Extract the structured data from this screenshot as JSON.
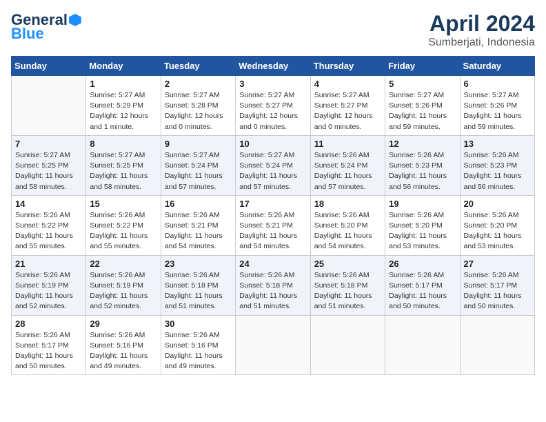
{
  "header": {
    "logo_general": "General",
    "logo_blue": "Blue",
    "month_title": "April 2024",
    "subtitle": "Sumberjati, Indonesia"
  },
  "days_of_week": [
    "Sunday",
    "Monday",
    "Tuesday",
    "Wednesday",
    "Thursday",
    "Friday",
    "Saturday"
  ],
  "weeks": [
    [
      {
        "day": "",
        "info": ""
      },
      {
        "day": "1",
        "info": "Sunrise: 5:27 AM\nSunset: 5:29 PM\nDaylight: 12 hours\nand 1 minute."
      },
      {
        "day": "2",
        "info": "Sunrise: 5:27 AM\nSunset: 5:28 PM\nDaylight: 12 hours\nand 0 minutes."
      },
      {
        "day": "3",
        "info": "Sunrise: 5:27 AM\nSunset: 5:27 PM\nDaylight: 12 hours\nand 0 minutes."
      },
      {
        "day": "4",
        "info": "Sunrise: 5:27 AM\nSunset: 5:27 PM\nDaylight: 12 hours\nand 0 minutes."
      },
      {
        "day": "5",
        "info": "Sunrise: 5:27 AM\nSunset: 5:26 PM\nDaylight: 11 hours\nand 59 minutes."
      },
      {
        "day": "6",
        "info": "Sunrise: 5:27 AM\nSunset: 5:26 PM\nDaylight: 11 hours\nand 59 minutes."
      }
    ],
    [
      {
        "day": "7",
        "info": "Sunrise: 5:27 AM\nSunset: 5:25 PM\nDaylight: 11 hours\nand 58 minutes."
      },
      {
        "day": "8",
        "info": "Sunrise: 5:27 AM\nSunset: 5:25 PM\nDaylight: 11 hours\nand 58 minutes."
      },
      {
        "day": "9",
        "info": "Sunrise: 5:27 AM\nSunset: 5:24 PM\nDaylight: 11 hours\nand 57 minutes."
      },
      {
        "day": "10",
        "info": "Sunrise: 5:27 AM\nSunset: 5:24 PM\nDaylight: 11 hours\nand 57 minutes."
      },
      {
        "day": "11",
        "info": "Sunrise: 5:26 AM\nSunset: 5:24 PM\nDaylight: 11 hours\nand 57 minutes."
      },
      {
        "day": "12",
        "info": "Sunrise: 5:26 AM\nSunset: 5:23 PM\nDaylight: 11 hours\nand 56 minutes."
      },
      {
        "day": "13",
        "info": "Sunrise: 5:26 AM\nSunset: 5:23 PM\nDaylight: 11 hours\nand 56 minutes."
      }
    ],
    [
      {
        "day": "14",
        "info": "Sunrise: 5:26 AM\nSunset: 5:22 PM\nDaylight: 11 hours\nand 55 minutes."
      },
      {
        "day": "15",
        "info": "Sunrise: 5:26 AM\nSunset: 5:22 PM\nDaylight: 11 hours\nand 55 minutes."
      },
      {
        "day": "16",
        "info": "Sunrise: 5:26 AM\nSunset: 5:21 PM\nDaylight: 11 hours\nand 54 minutes."
      },
      {
        "day": "17",
        "info": "Sunrise: 5:26 AM\nSunset: 5:21 PM\nDaylight: 11 hours\nand 54 minutes."
      },
      {
        "day": "18",
        "info": "Sunrise: 5:26 AM\nSunset: 5:20 PM\nDaylight: 11 hours\nand 54 minutes."
      },
      {
        "day": "19",
        "info": "Sunrise: 5:26 AM\nSunset: 5:20 PM\nDaylight: 11 hours\nand 53 minutes."
      },
      {
        "day": "20",
        "info": "Sunrise: 5:26 AM\nSunset: 5:20 PM\nDaylight: 11 hours\nand 53 minutes."
      }
    ],
    [
      {
        "day": "21",
        "info": "Sunrise: 5:26 AM\nSunset: 5:19 PM\nDaylight: 11 hours\nand 52 minutes."
      },
      {
        "day": "22",
        "info": "Sunrise: 5:26 AM\nSunset: 5:19 PM\nDaylight: 11 hours\nand 52 minutes."
      },
      {
        "day": "23",
        "info": "Sunrise: 5:26 AM\nSunset: 5:18 PM\nDaylight: 11 hours\nand 51 minutes."
      },
      {
        "day": "24",
        "info": "Sunrise: 5:26 AM\nSunset: 5:18 PM\nDaylight: 11 hours\nand 51 minutes."
      },
      {
        "day": "25",
        "info": "Sunrise: 5:26 AM\nSunset: 5:18 PM\nDaylight: 11 hours\nand 51 minutes."
      },
      {
        "day": "26",
        "info": "Sunrise: 5:26 AM\nSunset: 5:17 PM\nDaylight: 11 hours\nand 50 minutes."
      },
      {
        "day": "27",
        "info": "Sunrise: 5:26 AM\nSunset: 5:17 PM\nDaylight: 11 hours\nand 50 minutes."
      }
    ],
    [
      {
        "day": "28",
        "info": "Sunrise: 5:26 AM\nSunset: 5:17 PM\nDaylight: 11 hours\nand 50 minutes."
      },
      {
        "day": "29",
        "info": "Sunrise: 5:26 AM\nSunset: 5:16 PM\nDaylight: 11 hours\nand 49 minutes."
      },
      {
        "day": "30",
        "info": "Sunrise: 5:26 AM\nSunset: 5:16 PM\nDaylight: 11 hours\nand 49 minutes."
      },
      {
        "day": "",
        "info": ""
      },
      {
        "day": "",
        "info": ""
      },
      {
        "day": "",
        "info": ""
      },
      {
        "day": "",
        "info": ""
      }
    ]
  ]
}
